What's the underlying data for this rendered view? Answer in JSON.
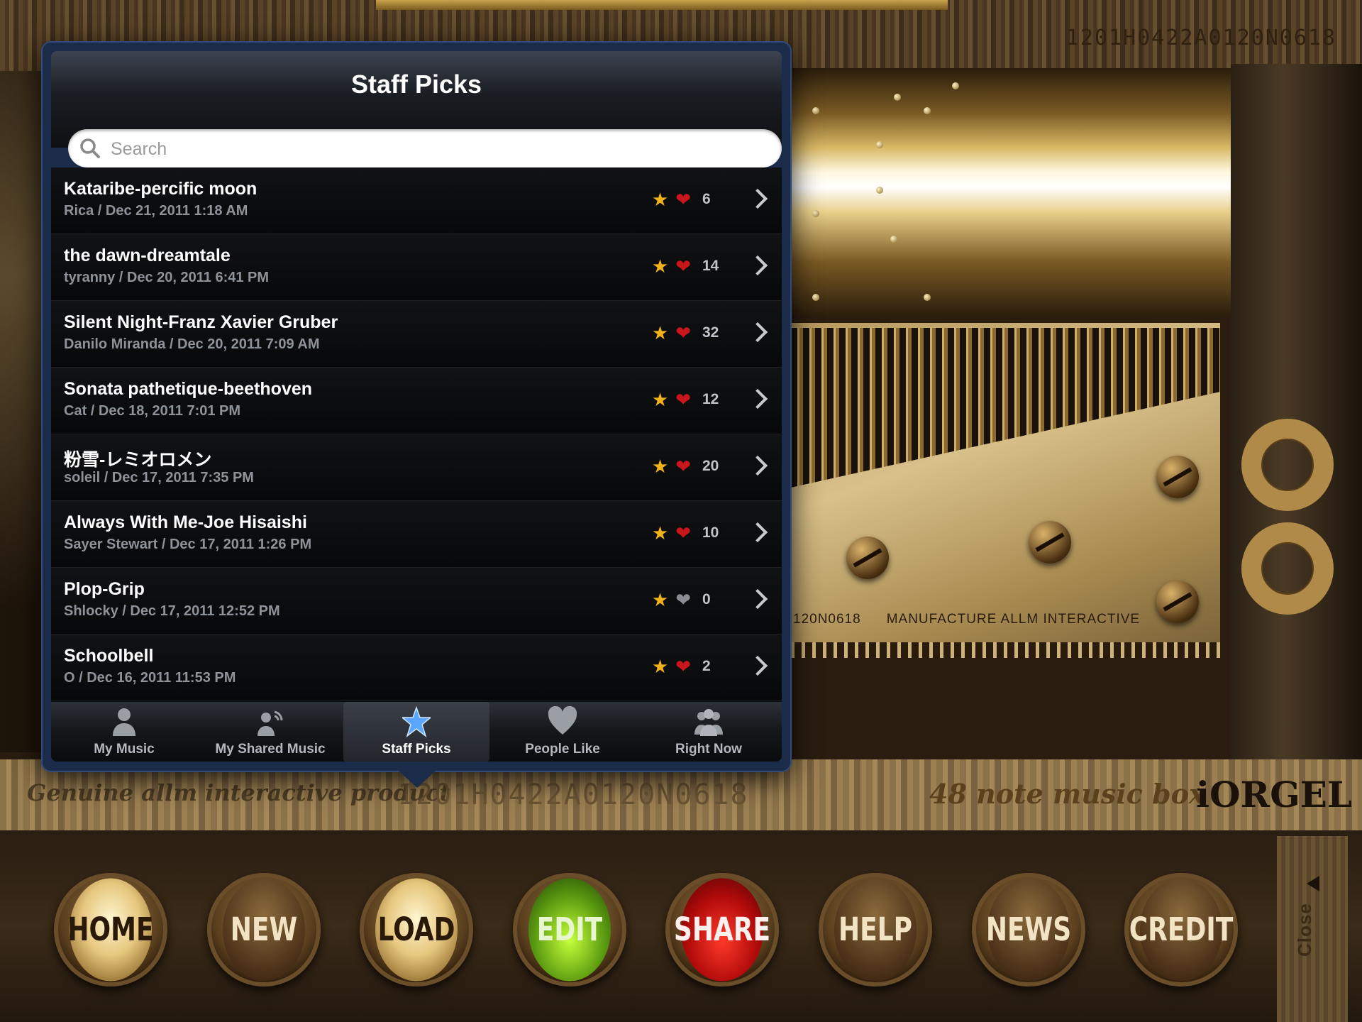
{
  "top_serial": "1201H0422A0120N0618",
  "plate": {
    "serial": "120N0618",
    "manufacture": "MANUFACTURE ALLM INTERACTIVE"
  },
  "band": {
    "genuine": "Genuine allm interactive product",
    "serial": "1201H0422A0120N0618",
    "note": "48 note music box",
    "brand": "iORGEL"
  },
  "popover": {
    "title": "Staff Picks",
    "search": {
      "placeholder": "Search",
      "value": ""
    },
    "items": [
      {
        "title": "Kataribe-percific moon",
        "subtitle": "Rica / Dec 21, 2011 1:18 AM",
        "likes": "6",
        "liked": true
      },
      {
        "title": "the dawn-dreamtale",
        "subtitle": "tyranny / Dec 20, 2011 6:41 PM",
        "likes": "14",
        "liked": true
      },
      {
        "title": "Silent Night-Franz Xavier Gruber",
        "subtitle": "Danilo Miranda / Dec 20, 2011 7:09 AM",
        "likes": "32",
        "liked": true
      },
      {
        "title": "Sonata pathetique-beethoven",
        "subtitle": "Cat / Dec 18, 2011 7:01 PM",
        "likes": "12",
        "liked": true
      },
      {
        "title": "粉雪-レミオロメン",
        "subtitle": "soleil / Dec 17, 2011 7:35 PM",
        "likes": "20",
        "liked": true
      },
      {
        "title": "Always With Me-Joe Hisaishi",
        "subtitle": "Sayer Stewart / Dec 17, 2011 1:26 PM",
        "likes": "10",
        "liked": true
      },
      {
        "title": "Plop-Grip",
        "subtitle": "Shlocky / Dec 17, 2011 12:52 PM",
        "likes": "0",
        "liked": false
      },
      {
        "title": "Schoolbell",
        "subtitle": "O / Dec 16, 2011 11:53 PM",
        "likes": "2",
        "liked": true
      }
    ],
    "tabs": [
      {
        "label": "My Music",
        "icon": "person-icon"
      },
      {
        "label": "My Shared Music",
        "icon": "shared-person-icon"
      },
      {
        "label": "Staff Picks",
        "icon": "star-icon",
        "active": true
      },
      {
        "label": "People Like",
        "icon": "heart-icon"
      },
      {
        "label": "Right Now",
        "icon": "group-icon"
      }
    ]
  },
  "buttons": [
    {
      "label": "HOME",
      "style": "gold"
    },
    {
      "label": "NEW",
      "style": "brown"
    },
    {
      "label": "LOAD",
      "style": "gold"
    },
    {
      "label": "EDIT",
      "style": "green"
    },
    {
      "label": "SHARE",
      "style": "red"
    },
    {
      "label": "HELP",
      "style": "brown"
    },
    {
      "label": "NEWS",
      "style": "brown"
    },
    {
      "label": "CREDIT",
      "style": "brown"
    }
  ],
  "close_label": "Close",
  "colors": {
    "accent_star": "#f2b21a",
    "heart": "#c8161c",
    "active_tab_star": "#5aa7ff"
  }
}
